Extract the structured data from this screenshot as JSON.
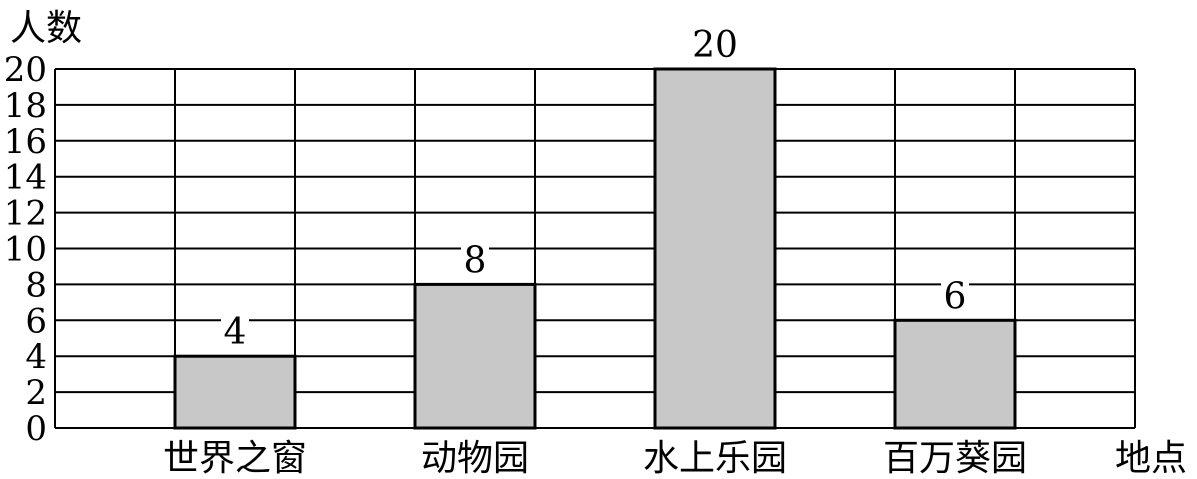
{
  "chart_data": {
    "type": "bar",
    "ylabel": "人数",
    "xlabel": "地点",
    "categories": [
      "世界之窗",
      "动物园",
      "水上乐园",
      "百万葵园"
    ],
    "values": [
      4,
      8,
      20,
      6
    ],
    "data_labels": [
      "4",
      "8",
      "20",
      "6"
    ],
    "ylim": [
      0,
      20
    ],
    "yticks": [
      "0",
      "2",
      "4",
      "6",
      "8",
      "10",
      "12",
      "14",
      "16",
      "18",
      "20"
    ],
    "grid": true,
    "bar_color": "#c8c8c8",
    "line_color": "#000000"
  }
}
